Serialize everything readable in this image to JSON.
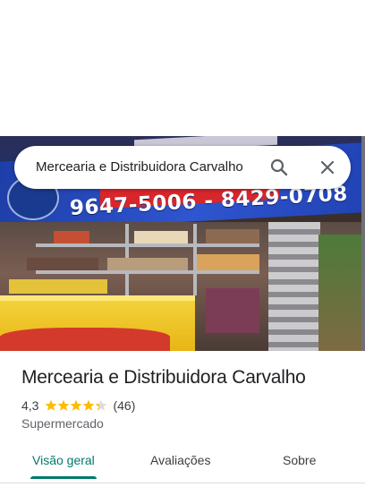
{
  "search": {
    "query": "Mercearia e Distribuidora Carvalho",
    "search_icon": "search-icon",
    "close_icon": "close-icon"
  },
  "photo": {
    "sign_phones": "9647-5006 -  8429-0708"
  },
  "place": {
    "title": "Mercearia e Distribuidora Carvalho",
    "rating": "4,3",
    "rating_value": 4.3,
    "rating_max": 5,
    "review_count": "(46)",
    "category": "Supermercado"
  },
  "tabs": [
    {
      "label": "Visão geral",
      "active": true
    },
    {
      "label": "Avaliações",
      "active": false
    },
    {
      "label": "Sobre",
      "active": false
    }
  ],
  "colors": {
    "accent": "#00796b",
    "star": "#fbbc04",
    "star_empty": "#dadce0"
  }
}
